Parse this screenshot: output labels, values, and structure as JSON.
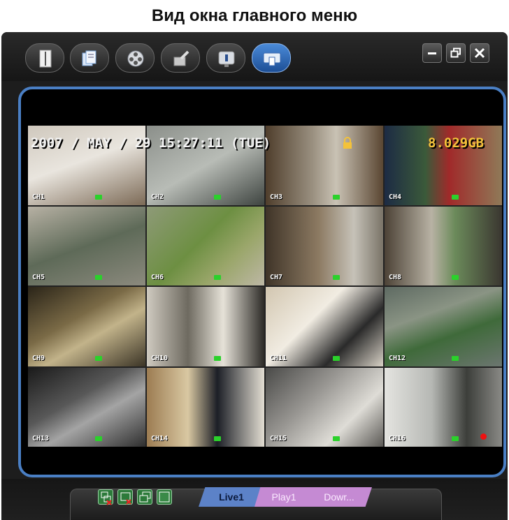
{
  "caption": "Вид окна главного меню",
  "toolbar": {
    "buttons": [
      {
        "name": "toolbar-button-1",
        "icon": "document-icon",
        "active": false
      },
      {
        "name": "toolbar-button-2",
        "icon": "pages-icon",
        "active": false
      },
      {
        "name": "toolbar-button-3",
        "icon": "film-reel-icon",
        "active": false
      },
      {
        "name": "toolbar-button-4",
        "icon": "tools-icon",
        "active": false
      },
      {
        "name": "toolbar-button-5",
        "icon": "info-icon",
        "active": false
      },
      {
        "name": "toolbar-button-6",
        "icon": "network-icon",
        "active": true
      }
    ]
  },
  "window_controls": {
    "minimize": "minimize-icon",
    "restore": "restore-icon",
    "close": "close-icon"
  },
  "osd": {
    "datetime": "2007 / MAY / 29 15:27:11 (TUE)",
    "storage": "8.029GB"
  },
  "channels": [
    "CH1",
    "CH2",
    "CH3",
    "CH4",
    "CH5",
    "CH6",
    "CH7",
    "CH8",
    "CH9",
    "CH10",
    "CH11",
    "CH12",
    "CH13",
    "CH14",
    "CH15",
    "CH16"
  ],
  "bottom": {
    "tabs": [
      "Live1",
      "Play1",
      "Dowr..."
    ],
    "controls": [
      "split-view-icon",
      "close-view-icon",
      "single-view-icon",
      "blank-view-icon"
    ]
  },
  "colors": {
    "accent": "#4a7fc4",
    "live_tab": "#5c82c8",
    "play_tab": "#c58ad3"
  }
}
